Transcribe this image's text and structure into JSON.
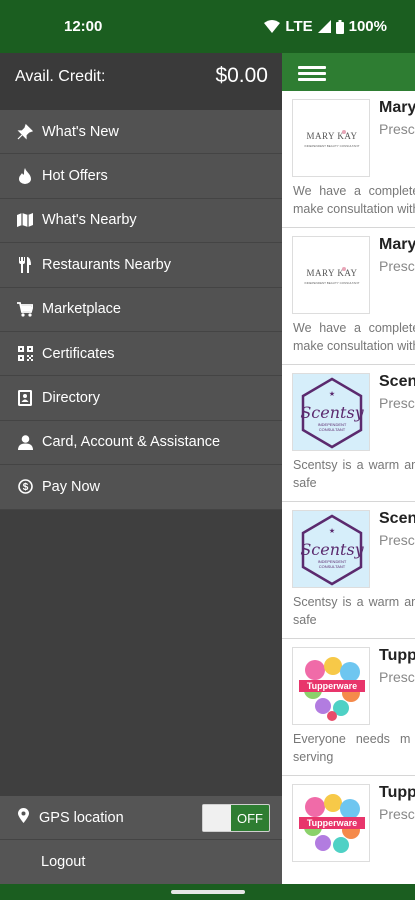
{
  "status_bar": {
    "time": "12:00",
    "network": "LTE",
    "battery": "100%"
  },
  "drawer": {
    "credit_label": "Avail. Credit:",
    "credit_value": "$0.00",
    "menu": [
      {
        "label": "What's New",
        "icon": "pin-icon"
      },
      {
        "label": "Hot Offers",
        "icon": "fire-icon"
      },
      {
        "label": "What's Nearby",
        "icon": "map-icon"
      },
      {
        "label": "Restaurants Nearby",
        "icon": "utensils-icon"
      },
      {
        "label": "Marketplace",
        "icon": "cart-icon"
      },
      {
        "label": "Certificates",
        "icon": "qr-code-icon"
      },
      {
        "label": "Directory",
        "icon": "directory-icon"
      },
      {
        "label": "Card, Account & Assistance",
        "icon": "user-icon"
      },
      {
        "label": "Pay Now",
        "icon": "dollar-circle-icon"
      }
    ],
    "gps_label": "GPS location",
    "gps_toggle": "OFF",
    "logout_label": "Logout"
  },
  "listings": [
    {
      "name": "Mary",
      "location": "Presc",
      "logo_text": "MARY KAY",
      "logo_sub": "INDEPENDENT BEAUTY CONSULTANT",
      "description": "We have a complete products to make consultation with m"
    },
    {
      "name": "Mary",
      "location": "Presc",
      "logo_text": "MARY KAY",
      "logo_sub": "INDEPENDENT BEAUTY CONSULTANT",
      "description": "We have a complete products to make consultation with m"
    },
    {
      "name": "Scents",
      "location": "Presc",
      "logo_text": "Scentsy",
      "logo_sub": "INDEPENDENT CONSULTANT",
      "description": "Scentsy is a warm amazing. It is a safe"
    },
    {
      "name": "Scen",
      "location": "Presc",
      "logo_text": "Scentsy",
      "logo_sub": "INDEPENDENT CONSULTANT",
      "description": "Scentsy is a warm amazing. It is a safe"
    },
    {
      "name": "Tupp",
      "location": "Presc",
      "logo_text": "Tupperware",
      "logo_sub": "",
      "description": "Everyone needs m storage and serving"
    },
    {
      "name": "Tupp",
      "location": "Presc",
      "logo_text": "Tupperware",
      "logo_sub": "",
      "description": ""
    }
  ],
  "colors": {
    "header_green": "#1b5e20",
    "app_bar_green": "#2e7d32",
    "drawer_bg": "#525252",
    "scentsy_purple": "#5b2a6e"
  }
}
